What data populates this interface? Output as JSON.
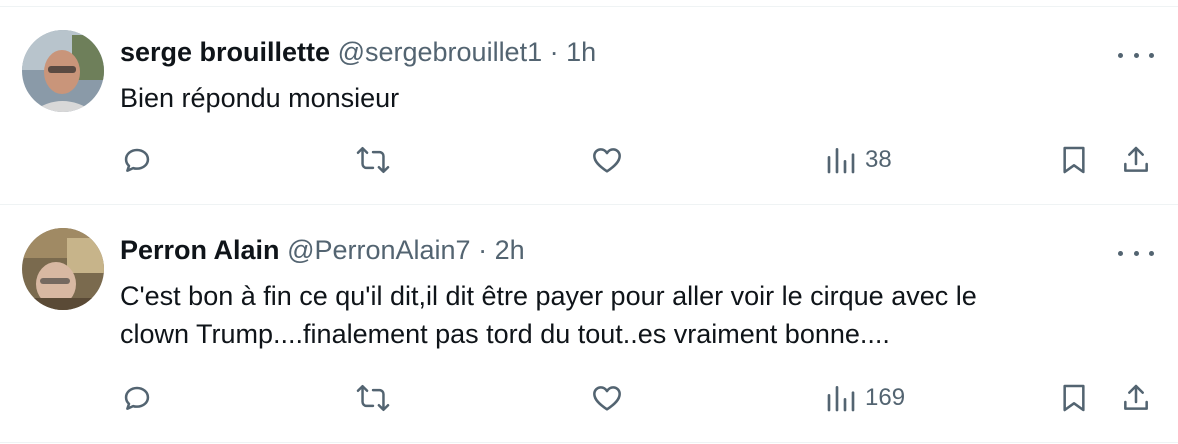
{
  "tweets": [
    {
      "display_name": "serge brouillette",
      "handle": "@sergebrouillet1",
      "separator": "·",
      "time": "1h",
      "text_lines": [
        "Bien répondu monsieur"
      ],
      "views": "38"
    },
    {
      "display_name": "Perron Alain",
      "handle": "@PerronAlain7",
      "separator": "·",
      "time": "2h",
      "text_lines": [
        "C'est bon à fin ce qu'il dit,il dit être payer pour aller voir le cirque avec le",
        "clown Trump....finalement pas tord du tout..es vraiment bonne...."
      ],
      "views": "169"
    }
  ],
  "icons": {
    "reply": "reply-icon",
    "retweet": "retweet-icon",
    "like": "heart-icon",
    "views": "views-chart-icon",
    "bookmark": "bookmark-icon",
    "share": "share-icon",
    "more": "more-icon"
  },
  "colors": {
    "text": "#0f1419",
    "secondary": "#536471",
    "divider": "#eff3f4"
  }
}
